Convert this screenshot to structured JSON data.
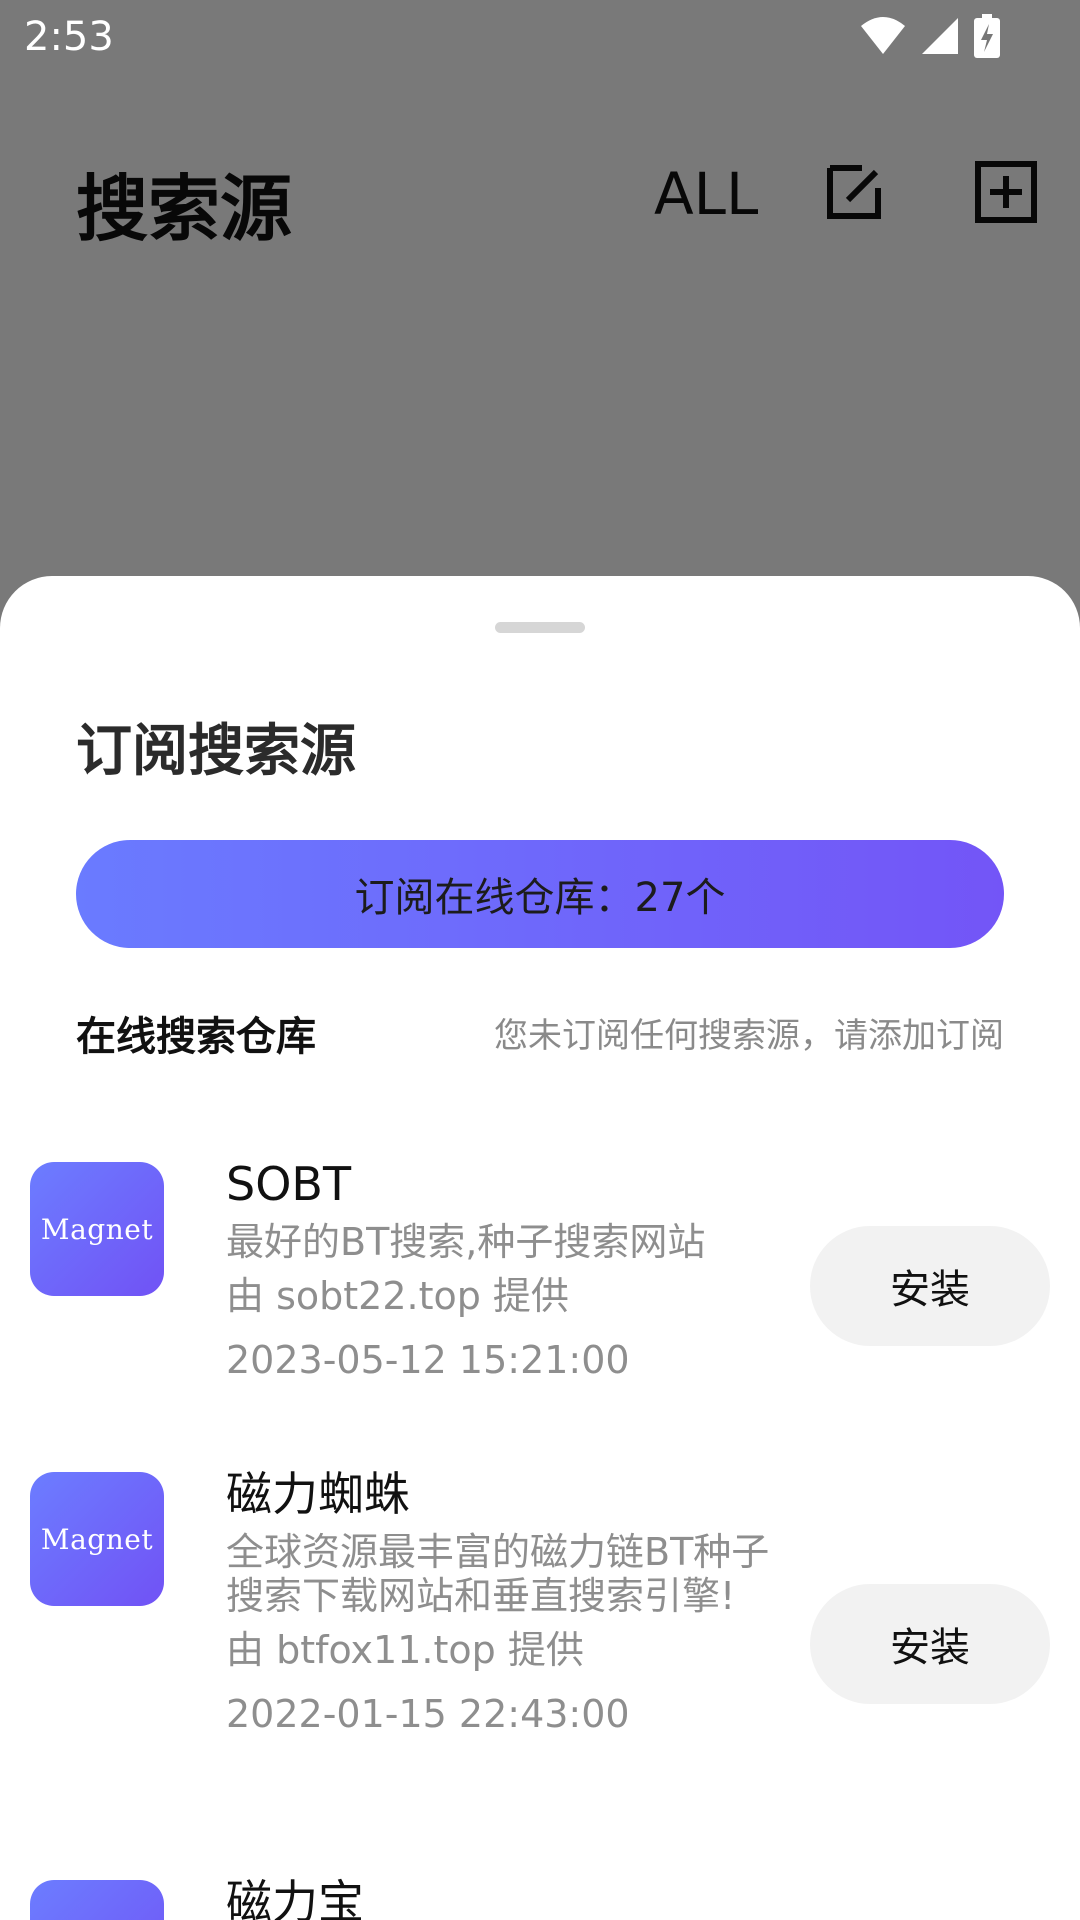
{
  "status_bar": {
    "time": "2:53",
    "icons": [
      "wifi-icon",
      "signal-icon",
      "battery-charging-icon"
    ]
  },
  "app_header": {
    "title": "搜索源",
    "filter_label": "ALL",
    "icons": [
      "edit-icon",
      "add-box-icon"
    ]
  },
  "sheet": {
    "title": "订阅搜索源",
    "subscribe_button": "订阅在线仓库：27个",
    "repo_label": "在线搜索仓库",
    "repo_hint": "您未订阅任何搜索源，请添加订阅",
    "accent_gradient": [
      "#6a7bff",
      "#7355f7"
    ],
    "items": [
      {
        "logo_text": "Magnet",
        "name": "SOBT",
        "desc": "最好的BT搜索,种子搜索网站",
        "provider": "由 sobt22.top 提供",
        "date": "2023-05-12 15:21:00",
        "action": "安装"
      },
      {
        "logo_text": "Magnet",
        "name": "磁力蜘蛛",
        "desc": "全球资源最丰富的磁力链BT种子搜索下载网站和垂直搜索引擎!",
        "provider": "由 btfox11.top 提供",
        "date": "2022-01-15 22:43:00",
        "action": "安装"
      },
      {
        "logo_text": "",
        "name": "磁力宝",
        "desc": "",
        "provider": "",
        "date": "",
        "action": ""
      }
    ]
  }
}
